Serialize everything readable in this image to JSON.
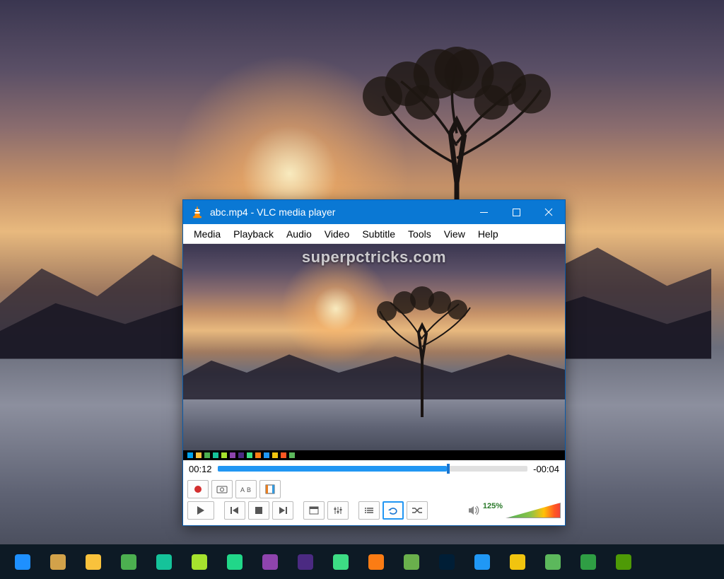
{
  "vlc": {
    "title": "abc.mp4 - VLC media player",
    "menu": [
      "Media",
      "Playback",
      "Audio",
      "Video",
      "Subtitle",
      "Tools",
      "View",
      "Help"
    ],
    "watermark": "superpctricks.com",
    "elapsed": "00:12",
    "remaining": "-00:04",
    "volume_pct": "125%",
    "seek_progress_pct": 74
  },
  "icons": {
    "cone": "vlc-cone-icon",
    "minimize": "minimize-icon",
    "maximize": "maximize-icon",
    "close": "close-icon",
    "record": "record-icon",
    "snapshot": "snapshot-icon",
    "atob": "a-to-b-loop-icon",
    "frame": "frame-by-frame-icon",
    "play": "play-icon",
    "prev": "previous-icon",
    "stop": "stop-icon",
    "next": "next-icon",
    "fullscreen": "fullscreen-icon",
    "extended": "extended-settings-icon",
    "playlist": "playlist-icon",
    "loop": "loop-icon",
    "shuffle": "shuffle-icon",
    "speaker": "speaker-icon"
  },
  "taskbar_apps": [
    {
      "name": "snip-tool",
      "color": "#1e90ff"
    },
    {
      "name": "putty",
      "color": "#d2a24a"
    },
    {
      "name": "chrome-canary",
      "color": "#f9c23c"
    },
    {
      "name": "chrome",
      "color": "#4caf50"
    },
    {
      "name": "grammarly",
      "color": "#15c39a"
    },
    {
      "name": "notepadpp",
      "color": "#a6e22e"
    },
    {
      "name": "pycharm",
      "color": "#21d789"
    },
    {
      "name": "visual-studio",
      "color": "#8e44ad"
    },
    {
      "name": "after-effects",
      "color": "#4b2a82"
    },
    {
      "name": "android-studio",
      "color": "#3ddc84"
    },
    {
      "name": "xampp",
      "color": "#fb7c14"
    },
    {
      "name": "jdownloader",
      "color": "#6ab04c"
    },
    {
      "name": "photoshop",
      "color": "#001e36"
    },
    {
      "name": "brackets",
      "color": "#2098f5"
    },
    {
      "name": "map",
      "color": "#f1c40f"
    },
    {
      "name": "camtasia",
      "color": "#5cb85c"
    },
    {
      "name": "earth",
      "color": "#2f9e44"
    },
    {
      "name": "camtasia2",
      "color": "#4e9a06"
    }
  ]
}
